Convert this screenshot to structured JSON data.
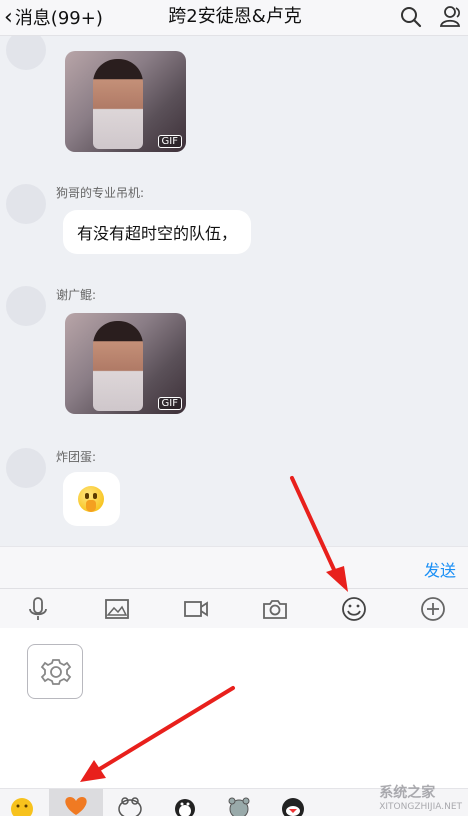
{
  "header": {
    "back_label": "消息(99+)",
    "title": "跨2安徒恩&卢克"
  },
  "messages": [
    {
      "sender": "",
      "type": "gif",
      "badge": "GIF"
    },
    {
      "sender": "狗哥的专业吊机:",
      "type": "text",
      "text": "有没有超时空的队伍，"
    },
    {
      "sender": "谢广鲲:",
      "type": "gif",
      "badge": "GIF"
    },
    {
      "sender": "炸团蛋:",
      "type": "emoji",
      "emoji": "shushing-face"
    }
  ],
  "input": {
    "send_label": "发送"
  },
  "toolbar": {
    "icons": [
      "microphone-icon",
      "image-icon",
      "video-icon",
      "camera-icon",
      "emoji-icon",
      "plus-icon"
    ]
  },
  "sticker_tabs": [
    "emoji-tab",
    "favorites-tab",
    "sticker-tab-1",
    "sticker-tab-2",
    "sticker-tab-3",
    "sticker-tab-4"
  ],
  "watermark": {
    "main": "系统之家",
    "sub": "XITONGZHIJIA.NET"
  },
  "colors": {
    "accent": "#1a8ff5",
    "arrow": "#e8201c",
    "heart": "#f07a22"
  }
}
